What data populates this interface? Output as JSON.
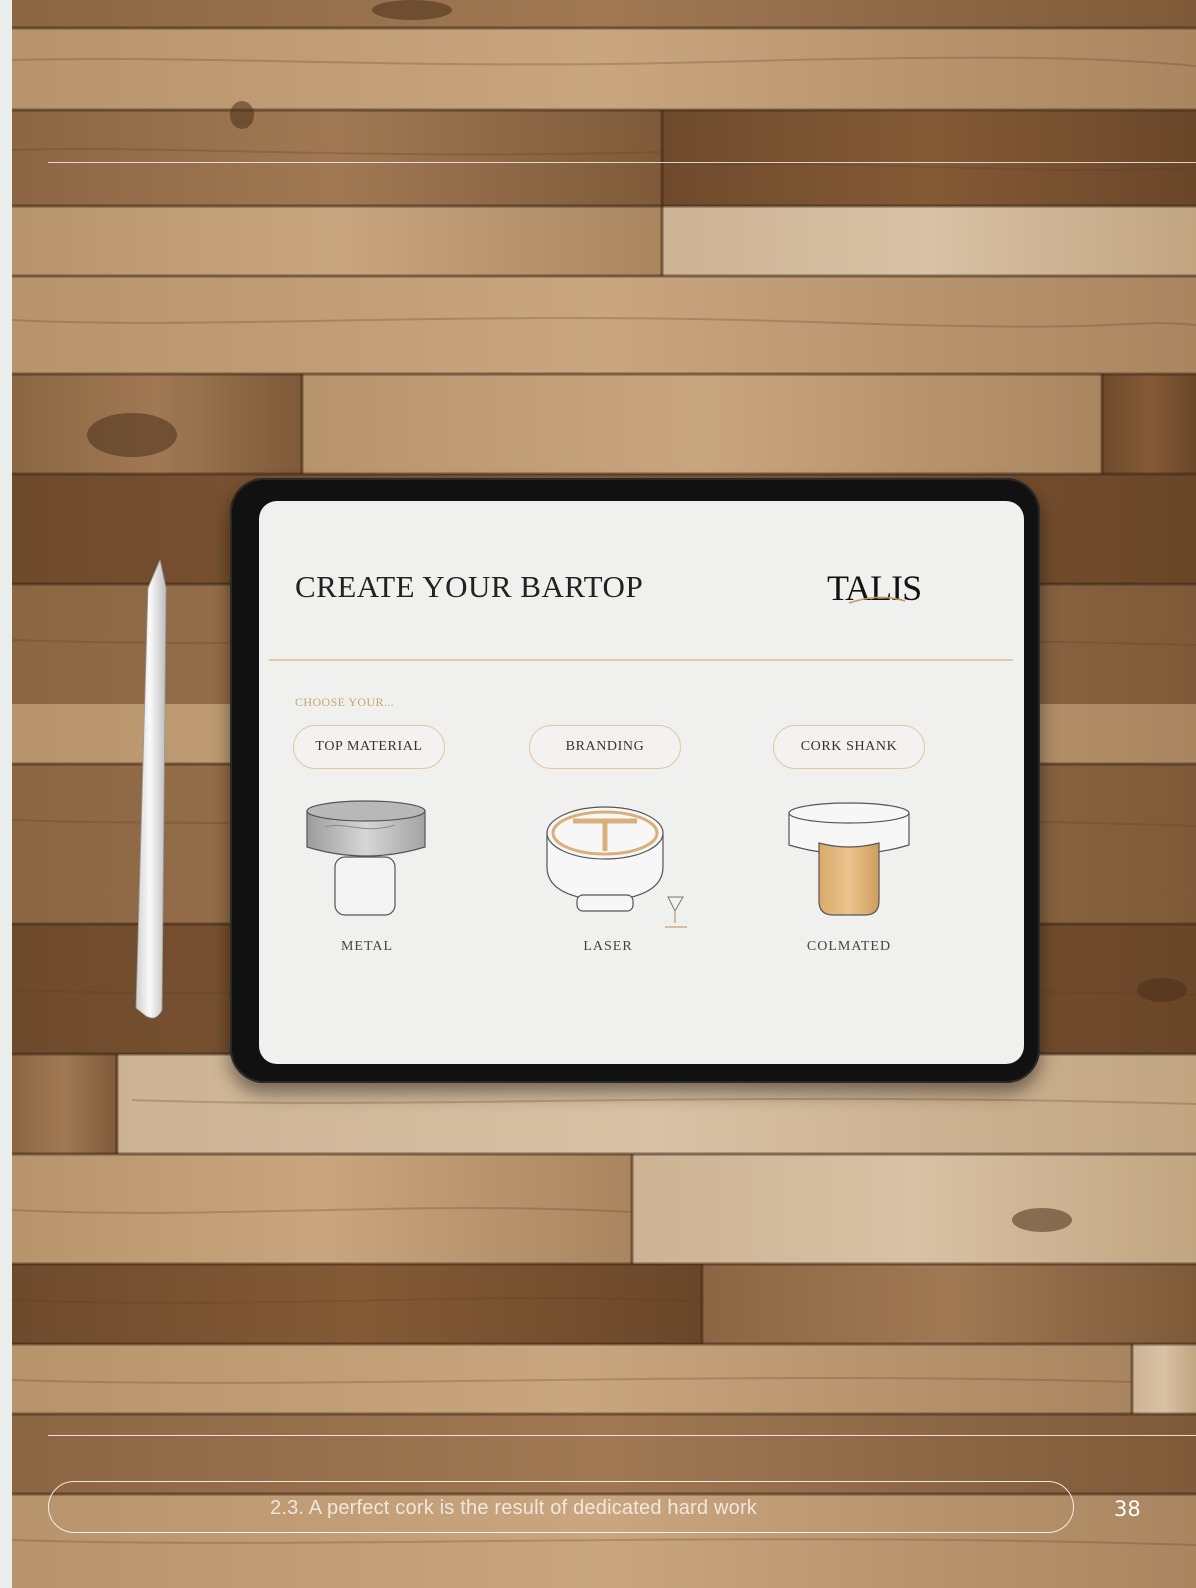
{
  "app": {
    "title": "CREATE YOUR BARTOP",
    "logo": "TALIS",
    "choose_label": "CHOOSE YOUR..."
  },
  "options": [
    {
      "button_label": "TOP MATERIAL",
      "choice_label": "METAL",
      "icon": "metal-bartop-icon"
    },
    {
      "button_label": "BRANDING",
      "choice_label": "LASER",
      "icon": "laser-branding-icon"
    },
    {
      "button_label": "CORK SHANK",
      "choice_label": "COLMATED",
      "icon": "colmated-cork-icon"
    }
  ],
  "footer": {
    "caption": "2.3. A perfect cork is the result of dedicated hard work",
    "page_number": "38"
  },
  "colors": {
    "accent": "#e3c49c",
    "wood": "#8a6a4c"
  }
}
